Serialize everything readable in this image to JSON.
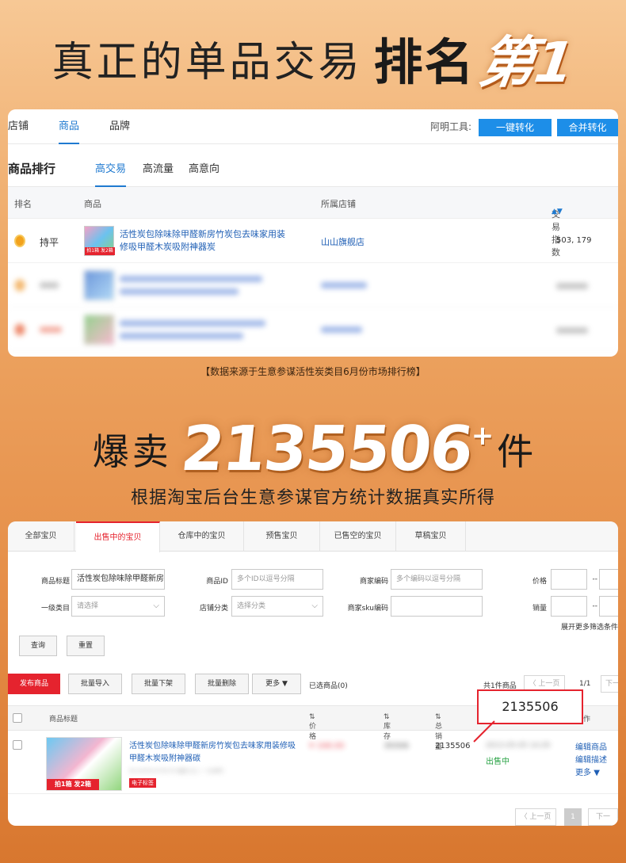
{
  "headline": {
    "main": "真正的单品交易",
    "rank": "排名",
    "first": "第1"
  },
  "ranking": {
    "nav_tabs": [
      "店铺",
      "商品",
      "品牌"
    ],
    "tool_label": "阿明工具:",
    "tool_buttons": [
      "一键转化",
      "合并转化"
    ],
    "section_title": "商品排行",
    "sub_tabs": [
      "高交易",
      "高流量",
      "高意向"
    ],
    "columns": {
      "rank": "排名",
      "product": "商品",
      "shop": "所属店铺",
      "index": "交易指数"
    },
    "rows": [
      {
        "trend": "持平",
        "badge": "拍1箱 发2箱",
        "product": "活性炭包除味除甲醛新房竹炭包去味家用装修吸甲醛木炭吸附神器炭",
        "shop": "山山旗舰店",
        "index": "503, 179"
      }
    ]
  },
  "source_note": "【数据来源于生意参谋活性炭类目6月份市场排行榜】",
  "sales": {
    "prefix": "爆卖",
    "number": "2135506",
    "plus": "+",
    "suffix": "件",
    "subtitle": "根据淘宝后台生意参谋官方统计数据真实所得"
  },
  "seller": {
    "tabs": [
      "全部宝贝",
      "出售中的宝贝",
      "仓库中的宝贝",
      "预售宝贝",
      "已售空的宝贝",
      "草稿宝贝"
    ],
    "filters": {
      "title_label": "商品标题",
      "title_value": "活性炭包除味除甲醛新房",
      "id_label": "商品ID",
      "id_placeholder": "多个ID以逗号分隔",
      "code_label": "商家编码",
      "code_placeholder": "多个编码以逗号分隔",
      "price_label": "价格",
      "cat_label": "一级类目",
      "cat_placeholder": "请选择",
      "shopcat_label": "店铺分类",
      "shopcat_placeholder": "选择分类",
      "sku_label": "商家sku编码",
      "sales_label": "销量",
      "range_sep": "--",
      "more": "展开更多筛选条件"
    },
    "query_button": "查询",
    "reset_button": "重置",
    "actions": {
      "publish": "发布商品",
      "import": "批量导入",
      "offshelf": "批量下架",
      "delete": "批量删除",
      "more": "更多",
      "selected": "已选商品(0)"
    },
    "pager": {
      "total": "共1件商品",
      "prev": "〈 上一页",
      "page": "1/1",
      "next": "下一",
      "current": "1"
    },
    "columns": {
      "title": "商品标题",
      "price": "价格",
      "stock": "库存",
      "sales": "总销量",
      "action": "作"
    },
    "row": {
      "thumb_tag": "拍1箱 发2箱",
      "title": "活性炭包除味除甲醛新房竹炭包去味家用装修吸甲醛木炭吸附神器碳",
      "id": "ID:20351479279 编码:无 | 一主单时",
      "etag": "电子标签",
      "price": "¥ 168.00",
      "stock": "39306",
      "sales": "2135506",
      "time": "2013-05-05 14:29",
      "status": "出售中",
      "edit": "编辑商品",
      "desc": "编辑描述",
      "more": "更多"
    },
    "callout": "2135506"
  },
  "colors": {
    "accent_blue": "#1f7ad0",
    "accent_red": "#e5232e",
    "status_green": "#27a243"
  }
}
